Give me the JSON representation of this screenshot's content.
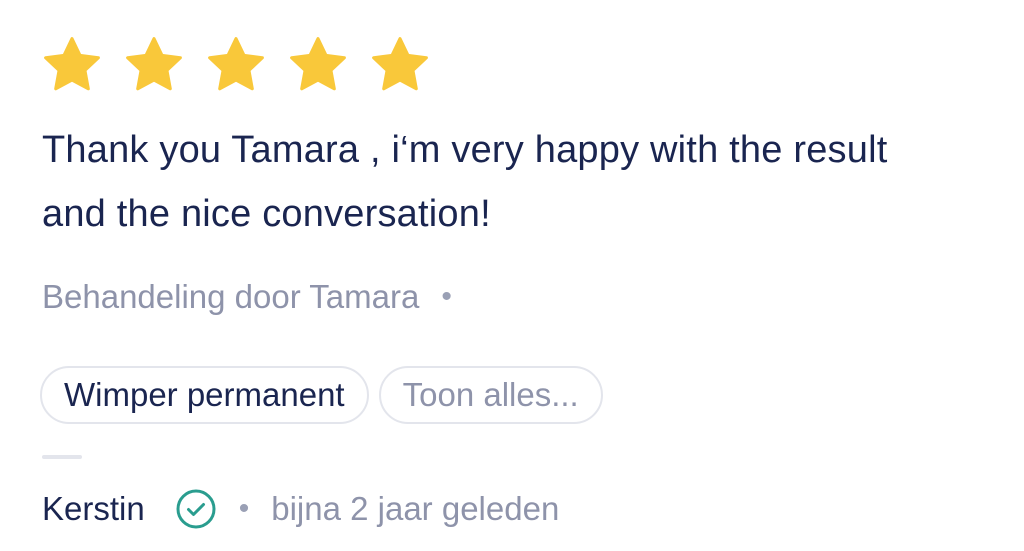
{
  "review": {
    "rating": 5,
    "rating_max": 5,
    "star_color": "#F9C83A",
    "comment": "Thank you Tamara , i‘m very happy with the result and the nice conversation!",
    "treatment_text": "Behandeling door Tamara",
    "separator": "•",
    "tags": [
      {
        "label": "Wimper permanent"
      },
      {
        "label": "Toon alles..."
      }
    ],
    "author": "Kerstin",
    "verified_icon": "check-circle-icon",
    "verified_color": "#2A9D8F",
    "date": "bijna 2 jaar geleden"
  }
}
